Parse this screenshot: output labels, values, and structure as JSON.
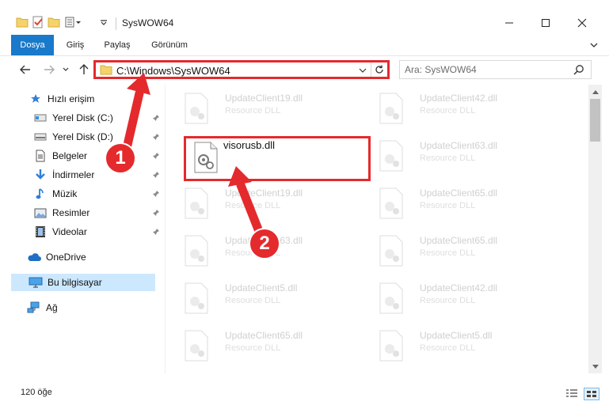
{
  "window": {
    "title": "SysWOW64",
    "controls": {
      "minimize": "—",
      "maximize": "☐",
      "close": "✕"
    }
  },
  "ribbon": {
    "tabs": [
      {
        "label": "Dosya"
      },
      {
        "label": "Giriş"
      },
      {
        "label": "Paylaş"
      },
      {
        "label": "Görünüm"
      }
    ]
  },
  "address": {
    "path": "C:\\Windows\\SysWOW64",
    "search_placeholder": "Ara: SysWOW64"
  },
  "sidebar": {
    "items": [
      {
        "label": "Hızlı erişim",
        "icon": "star-icon"
      },
      {
        "label": "Yerel Disk (C:)",
        "icon": "drive-icon"
      },
      {
        "label": "Yerel Disk (D:)",
        "icon": "drive-icon"
      },
      {
        "label": "Belgeler",
        "icon": "documents-icon"
      },
      {
        "label": "İndirmeler",
        "icon": "download-icon"
      },
      {
        "label": "Müzik",
        "icon": "music-icon"
      },
      {
        "label": "Resimler",
        "icon": "pictures-icon"
      },
      {
        "label": "Videolar",
        "icon": "video-icon"
      },
      {
        "label": "OneDrive",
        "icon": "cloud-icon"
      },
      {
        "label": "Bu bilgisayar",
        "icon": "computer-icon"
      },
      {
        "label": "Ağ",
        "icon": "network-icon"
      }
    ]
  },
  "files": {
    "left": [
      {
        "name": "UpdateClient19.dll",
        "type": "Resource DLL"
      },
      {
        "name": "visorusb.dll",
        "type": ""
      },
      {
        "name": "UpdateClient19.dll",
        "type": "Resource DLL"
      },
      {
        "name": "UpdateClient63.dll",
        "type": "Resource DLL"
      },
      {
        "name": "UpdateClient5.dll",
        "type": "Resource DLL"
      },
      {
        "name": "UpdateClient65.dll",
        "type": "Resource DLL"
      }
    ],
    "right": [
      {
        "name": "UpdateClient42.dll",
        "type": "Resource DLL"
      },
      {
        "name": "UpdateClient63.dll",
        "type": "Resource DLL"
      },
      {
        "name": "UpdateClient65.dll",
        "type": "Resource DLL"
      },
      {
        "name": "UpdateClient65.dll",
        "type": "Resource DLL"
      },
      {
        "name": "UpdateClient42.dll",
        "type": "Resource DLL"
      },
      {
        "name": "UpdateClient5.dll",
        "type": "Resource DLL"
      }
    ]
  },
  "status": {
    "count": "120 öğe"
  },
  "annotations": {
    "step1": "1",
    "step2": "2"
  },
  "colors": {
    "accent": "#1979ca",
    "highlight": "#e42a2d",
    "selected": "#cce8ff"
  }
}
